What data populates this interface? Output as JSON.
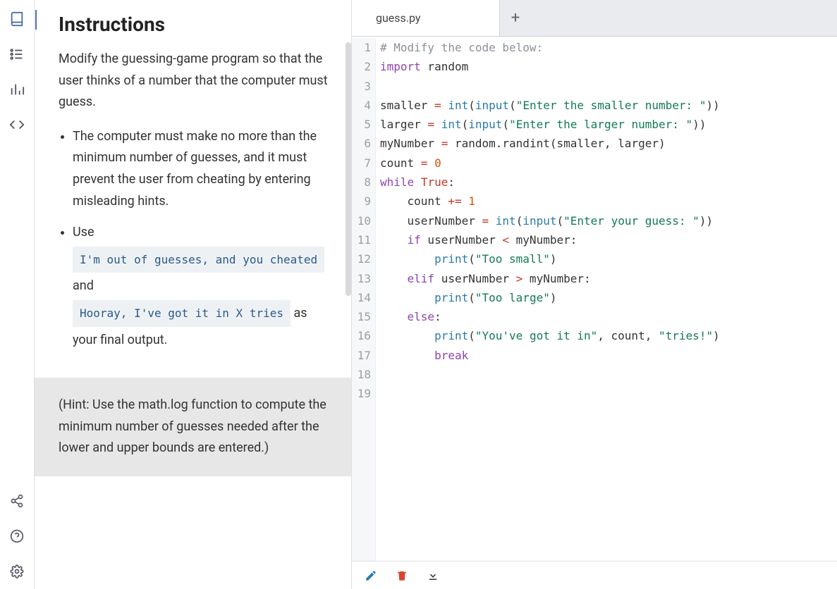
{
  "sidebar": {
    "icons": [
      "book-icon",
      "checklist-icon",
      "chart-icon",
      "code-icon",
      "share-icon",
      "help-icon",
      "settings-icon"
    ]
  },
  "instructions": {
    "title": "Instructions",
    "intro": "Modify the guessing-game program so that the user thinks of a number that the computer must guess.",
    "bullet1": "The computer must make no more than the minimum number of guesses, and it must prevent the user from cheating by entering misleading hints.",
    "bullet2_prefix": "Use",
    "code1": "I'm out of guesses, and you cheated",
    "bullet2_mid": "and",
    "code2": "Hooray, I've got it in X tries",
    "bullet2_suffix": " as your final output.",
    "hint": "(Hint: Use the math.log function to compute the minimum number of guesses needed after the lower and upper bounds are entered.)"
  },
  "editor": {
    "tab_name": "guess.py",
    "add_tab": "+",
    "line_count": 19,
    "code": [
      {
        "n": 1,
        "t": [
          [
            "# Modify the code below:",
            "comment"
          ]
        ]
      },
      {
        "n": 2,
        "t": [
          [
            "import",
            "keyword"
          ],
          [
            " random",
            "plain"
          ]
        ]
      },
      {
        "n": 3,
        "t": [
          [
            "",
            "plain"
          ]
        ]
      },
      {
        "n": 4,
        "t": [
          [
            "smaller ",
            "plain"
          ],
          [
            "=",
            "op"
          ],
          [
            " ",
            "plain"
          ],
          [
            "int",
            "builtin"
          ],
          [
            "(",
            "plain"
          ],
          [
            "input",
            "builtin"
          ],
          [
            "(",
            "plain"
          ],
          [
            "\"Enter the smaller number: \"",
            "string"
          ],
          [
            "))",
            "plain"
          ]
        ]
      },
      {
        "n": 5,
        "t": [
          [
            "larger ",
            "plain"
          ],
          [
            "=",
            "op"
          ],
          [
            " ",
            "plain"
          ],
          [
            "int",
            "builtin"
          ],
          [
            "(",
            "plain"
          ],
          [
            "input",
            "builtin"
          ],
          [
            "(",
            "plain"
          ],
          [
            "\"Enter the larger number: \"",
            "string"
          ],
          [
            "))",
            "plain"
          ]
        ]
      },
      {
        "n": 6,
        "t": [
          [
            "myNumber ",
            "plain"
          ],
          [
            "=",
            "op"
          ],
          [
            " random.randint(smaller, larger)",
            "plain"
          ]
        ]
      },
      {
        "n": 7,
        "t": [
          [
            "count ",
            "plain"
          ],
          [
            "=",
            "op"
          ],
          [
            " ",
            "plain"
          ],
          [
            "0",
            "number"
          ]
        ]
      },
      {
        "n": 8,
        "t": [
          [
            "while",
            "keyword"
          ],
          [
            " ",
            "plain"
          ],
          [
            "True",
            "const"
          ],
          [
            ":",
            "plain"
          ]
        ]
      },
      {
        "n": 9,
        "t": [
          [
            "    count ",
            "plain"
          ],
          [
            "+=",
            "op"
          ],
          [
            " ",
            "plain"
          ],
          [
            "1",
            "number"
          ]
        ]
      },
      {
        "n": 10,
        "t": [
          [
            "    userNumber ",
            "plain"
          ],
          [
            "=",
            "op"
          ],
          [
            " ",
            "plain"
          ],
          [
            "int",
            "builtin"
          ],
          [
            "(",
            "plain"
          ],
          [
            "input",
            "builtin"
          ],
          [
            "(",
            "plain"
          ],
          [
            "\"Enter your guess: \"",
            "string"
          ],
          [
            "))",
            "plain"
          ]
        ]
      },
      {
        "n": 11,
        "t": [
          [
            "    ",
            "plain"
          ],
          [
            "if",
            "keyword"
          ],
          [
            " userNumber ",
            "plain"
          ],
          [
            "<",
            "op"
          ],
          [
            " myNumber:",
            "plain"
          ]
        ]
      },
      {
        "n": 12,
        "t": [
          [
            "        ",
            "plain"
          ],
          [
            "print",
            "builtin"
          ],
          [
            "(",
            "plain"
          ],
          [
            "\"Too small\"",
            "string"
          ],
          [
            ")",
            "plain"
          ]
        ]
      },
      {
        "n": 13,
        "t": [
          [
            "    ",
            "plain"
          ],
          [
            "elif",
            "keyword"
          ],
          [
            " userNumber ",
            "plain"
          ],
          [
            ">",
            "op"
          ],
          [
            " myNumber:",
            "plain"
          ]
        ]
      },
      {
        "n": 14,
        "t": [
          [
            "        ",
            "plain"
          ],
          [
            "print",
            "builtin"
          ],
          [
            "(",
            "plain"
          ],
          [
            "\"Too large\"",
            "string"
          ],
          [
            ")",
            "plain"
          ]
        ]
      },
      {
        "n": 15,
        "t": [
          [
            "    ",
            "plain"
          ],
          [
            "else",
            "keyword"
          ],
          [
            ":",
            "plain"
          ]
        ]
      },
      {
        "n": 16,
        "t": [
          [
            "        ",
            "plain"
          ],
          [
            "print",
            "builtin"
          ],
          [
            "(",
            "plain"
          ],
          [
            "\"You've got it in\"",
            "string"
          ],
          [
            ", count, ",
            "plain"
          ],
          [
            "\"tries!\"",
            "string"
          ],
          [
            ")",
            "plain"
          ]
        ]
      },
      {
        "n": 17,
        "t": [
          [
            "        ",
            "plain"
          ],
          [
            "break",
            "keyword"
          ]
        ]
      },
      {
        "n": 18,
        "t": [
          [
            "",
            "plain"
          ]
        ]
      },
      {
        "n": 19,
        "t": [
          [
            "",
            "plain"
          ]
        ]
      }
    ]
  },
  "toolbar": {
    "icons": [
      "edit-icon",
      "delete-icon",
      "download-icon"
    ]
  }
}
